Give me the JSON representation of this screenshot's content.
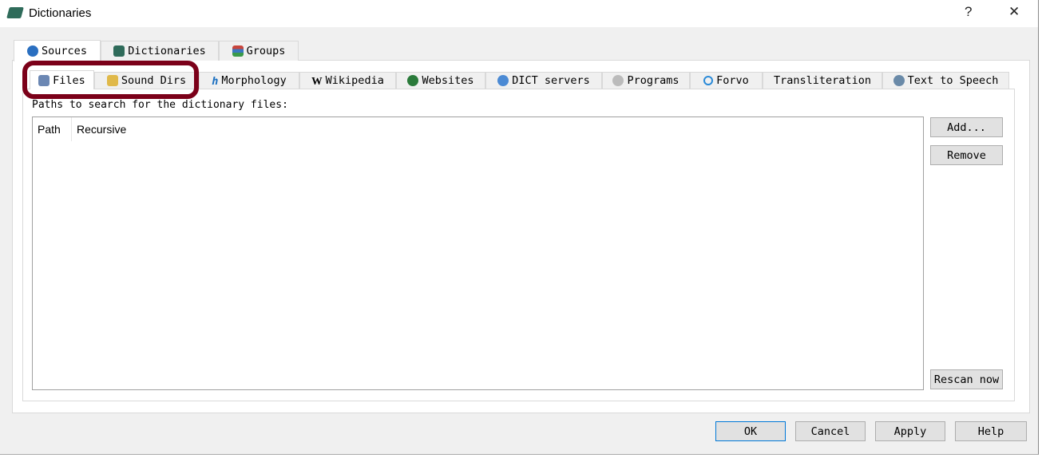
{
  "window": {
    "title": "Dictionaries",
    "help": "?",
    "close": "✕"
  },
  "outer_tabs": [
    {
      "label": "Sources",
      "icon": "refresh-icon",
      "color": "#2a6fc0"
    },
    {
      "label": "Dictionaries",
      "icon": "book-icon",
      "color": "#2f6b5a"
    },
    {
      "label": "Groups",
      "icon": "books-stack-icon",
      "color": "#c8453c"
    }
  ],
  "inner_tabs": [
    {
      "label": "Files",
      "icon": "floppy-icon"
    },
    {
      "label": "Sound Dirs",
      "icon": "folder-icon"
    },
    {
      "label": "Morphology",
      "icon": "h-icon"
    },
    {
      "label": "Wikipedia",
      "icon": "w-icon"
    },
    {
      "label": "Websites",
      "icon": "globe-icon"
    },
    {
      "label": "DICT servers",
      "icon": "server-icon"
    },
    {
      "label": "Programs",
      "icon": "gear-icon"
    },
    {
      "label": "Forvo",
      "icon": "circle-icon"
    },
    {
      "label": "Transliteration",
      "icon": ""
    },
    {
      "label": "Text to Speech",
      "icon": "speaker-icon"
    }
  ],
  "files": {
    "label": "Paths to search for the dictionary files:",
    "columns": [
      "Path",
      "Recursive"
    ],
    "add": "Add...",
    "remove": "Remove",
    "rescan": "Rescan now"
  },
  "footer": {
    "ok": "OK",
    "cancel": "Cancel",
    "apply": "Apply",
    "help": "Help"
  },
  "annotation_color": "#7b0019"
}
